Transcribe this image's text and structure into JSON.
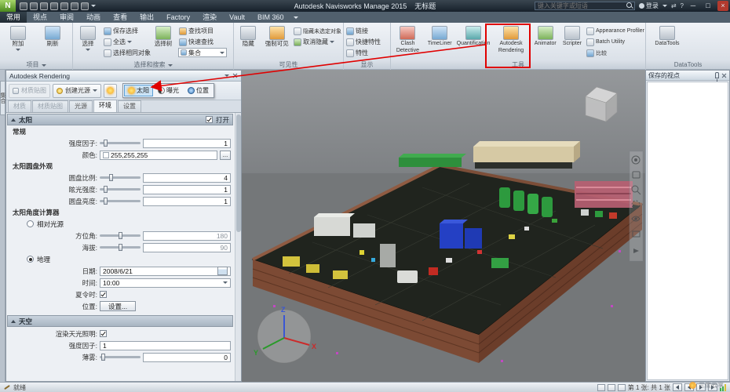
{
  "title_bar": {
    "app_button": "N",
    "title": "Autodesk Navisworks Manage 2015",
    "document": "无标题",
    "search_placeholder": "键入关键字或短语",
    "sign_in": "登录",
    "minimize": "─",
    "maximize": "□",
    "close": "×"
  },
  "ribbon": {
    "tabs": [
      "常用",
      "视点",
      "审阅",
      "动画",
      "查看",
      "输出",
      "Factory",
      "渲染",
      "Vault",
      "BIM 360"
    ],
    "project": {
      "label": "项目",
      "attach": "附加",
      "refresh": "刷新"
    },
    "select_search": {
      "label": "选择和搜索",
      "select": "选择",
      "save_selection": "保存选择",
      "select_all": "全选",
      "select_same": "选择相同对象",
      "selection_tree": "选择树",
      "sets": "集合",
      "find_items": "查找项目",
      "quick_find": "快速查找"
    },
    "visibility": {
      "label": "可见性",
      "hide": "隐藏",
      "require": "强制可见",
      "hide_unselected": "隐藏未选定对象",
      "unhide": "取消隐藏"
    },
    "display": {
      "label": "显示",
      "links": "链接",
      "quick_properties": "快捷特性",
      "properties": "特性"
    },
    "tools": {
      "label": "工具",
      "clash": "Clash Detective",
      "timeliner": "TimeLiner",
      "quantification": "Quantification",
      "rendering": "Autodesk Rendering",
      "animator": "Animator",
      "scripter": "Scripter",
      "appearance_profiler": "Appearance Profiler",
      "batch_utility": "Batch Utility",
      "compare": "比较"
    },
    "datatools": {
      "label": "DataTools",
      "button": "DataTools"
    }
  },
  "rendering_panel": {
    "title": "Autodesk Rendering",
    "toolbar": {
      "material_mapping": "材质贴图",
      "create_light": "创建光源",
      "sun": "太阳",
      "exposure": "曝光",
      "location": "位置"
    },
    "tabs": [
      "材质",
      "材质贴图",
      "光源",
      "环境",
      "设置"
    ],
    "sun": {
      "header": "太阳",
      "on": "打开",
      "general": "常规",
      "intensity_label": "强度因子:",
      "intensity": "1",
      "color_label": "颜色:",
      "color": "255,255,255",
      "color_more": "...",
      "disk": "太阳圆盘外观",
      "disk_scale_label": "圆盘比例:",
      "disk_scale": "4",
      "glow_label": "眩光强度:",
      "glow": "1",
      "brightness_label": "圆盘亮度:",
      "brightness": "1",
      "calculator": "太阳角度计算器",
      "relative": "相对光源",
      "azimuth_label": "方位角:",
      "azimuth": "180",
      "altitude_label": "海拔:",
      "altitude": "90",
      "geographic": "地理",
      "date_label": "日期:",
      "date": "2008/6/21",
      "time_label": "时间:",
      "time": "10:00",
      "dst_label": "夏令时:",
      "location_label": "位置:",
      "location_button": "设置..."
    },
    "sky": {
      "header": "天空",
      "skylight_label": "渲染天光照明:",
      "intensity_label": "强度因子:",
      "intensity": "1",
      "haze_label": "薄雾:",
      "haze": "0"
    }
  },
  "sets_tab": "集合",
  "viewpoints_panel": {
    "title": "保存的视点"
  },
  "viewport": {
    "axis_x": "X",
    "axis_y": "Y",
    "axis_z": "Z"
  },
  "status_bar": {
    "ready": "就绪",
    "page_info": "第 1 张: 共 1 张"
  },
  "watermark": "三度云享",
  "colors": {
    "annotation": "#e00000",
    "selection": "#cce4f7"
  }
}
